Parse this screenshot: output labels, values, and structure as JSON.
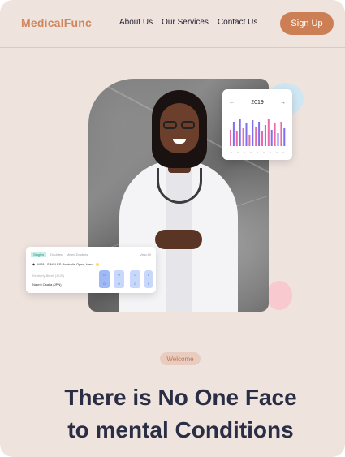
{
  "brand": {
    "name": "MedicalFunc"
  },
  "nav": {
    "items": [
      "About Us",
      "Our Services",
      "Contact Us"
    ],
    "cta": "Sign Up"
  },
  "chart_card": {
    "year": "2019",
    "prev_icon": "arrow-left-icon",
    "next_icon": "arrow-right-icon"
  },
  "schedule_card": {
    "tabs": [
      "Singles",
      "Doubles",
      "Mixed Doubles"
    ],
    "view_all": "View All",
    "match": "WTA - SINGLES: Australia Open, Hard",
    "players": [
      "Kimberly Birrell (AUS)",
      "Naomi Osaka (JPN)"
    ],
    "scores": [
      {
        "a": "0",
        "b": "0"
      },
      {
        "a": "0",
        "b": "0"
      },
      {
        "a": "0",
        "b": "0"
      },
      {
        "a": "0",
        "b": "0"
      }
    ]
  },
  "hero": {
    "welcome": "Welcome",
    "headline_line1": "There is No One Face",
    "headline_line2": "to mental Conditions"
  },
  "colors": {
    "accent": "#cc7f55",
    "background": "#efe3de",
    "headline": "#2a2e45"
  }
}
